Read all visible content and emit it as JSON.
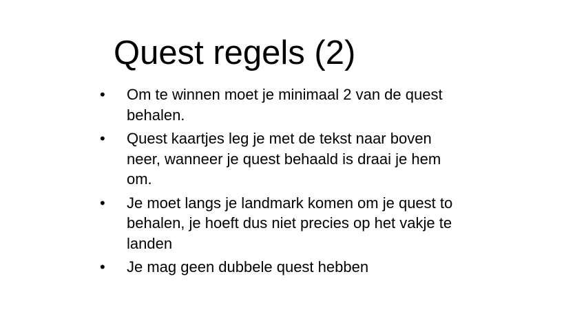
{
  "slide": {
    "title": "Quest regels (2)",
    "bullet_glyph": "•",
    "bullets": [
      {
        "line1": "Om te winnen moet je minimaal 2 van de quest",
        "line2": "behalen.",
        "line3": ""
      },
      {
        "line1": "Quest kaartjes leg je met de tekst naar boven",
        "line2": "neer, wanneer je quest behaald is draai je hem",
        "line3": "om."
      },
      {
        "line1": "Je moet langs je landmark komen om je quest to",
        "line2": "behalen, je hoeft dus niet precies op het vakje te",
        "line3": "landen"
      },
      {
        "line1": "Je mag geen dubbele quest hebben",
        "line2": "",
        "line3": ""
      }
    ]
  }
}
